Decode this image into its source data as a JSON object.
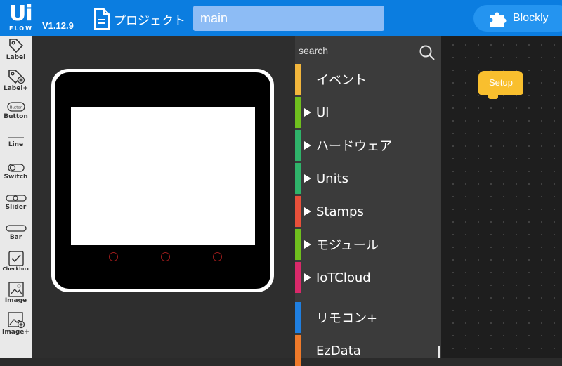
{
  "app": {
    "logo_text": "Ui",
    "logo_sub": "FLOW",
    "version": "V1.12.9",
    "project_label": "プロジェクト",
    "filename": "main",
    "mode_button": "Blockly",
    "accent_color": "#0b7de0"
  },
  "tools": [
    {
      "label": "Label",
      "icon": "label-tag-icon"
    },
    {
      "label": "Label+",
      "icon": "label-plus-icon"
    },
    {
      "label": "Button",
      "icon": "button-icon",
      "icon_text": "Button"
    },
    {
      "label": "Line",
      "icon": "line-icon"
    },
    {
      "label": "Switch",
      "icon": "switch-icon"
    },
    {
      "label": "Slider",
      "icon": "slider-icon"
    },
    {
      "label": "Bar",
      "icon": "bar-icon"
    },
    {
      "label": "Checkbox",
      "icon": "checkbox-icon"
    },
    {
      "label": "Image",
      "icon": "image-icon"
    },
    {
      "label": "Image+",
      "icon": "image-plus-icon"
    }
  ],
  "search": {
    "placeholder": "search"
  },
  "categories": [
    {
      "name": "イベント",
      "color": "#f2b63c",
      "expandable": false
    },
    {
      "name": "UI",
      "color": "#6fbf1e",
      "expandable": true
    },
    {
      "name": "ハードウェア",
      "color": "#2fb36a",
      "expandable": true
    },
    {
      "name": "Units",
      "color": "#2fb36a",
      "expandable": true
    },
    {
      "name": "Stamps",
      "color": "#e8503a",
      "expandable": true
    },
    {
      "name": "モジュール",
      "color": "#6fbf1e",
      "expandable": true
    },
    {
      "name": "IoTCloud",
      "color": "#d9296a",
      "expandable": true
    },
    {
      "name": "リモコン+",
      "color": "#1f7fe0",
      "expandable": false
    },
    {
      "name": "EzData",
      "color": "#ef7a2a",
      "expandable": false
    }
  ],
  "workspace": {
    "setup_block": "Setup",
    "block_color": "#f9bf2e"
  }
}
